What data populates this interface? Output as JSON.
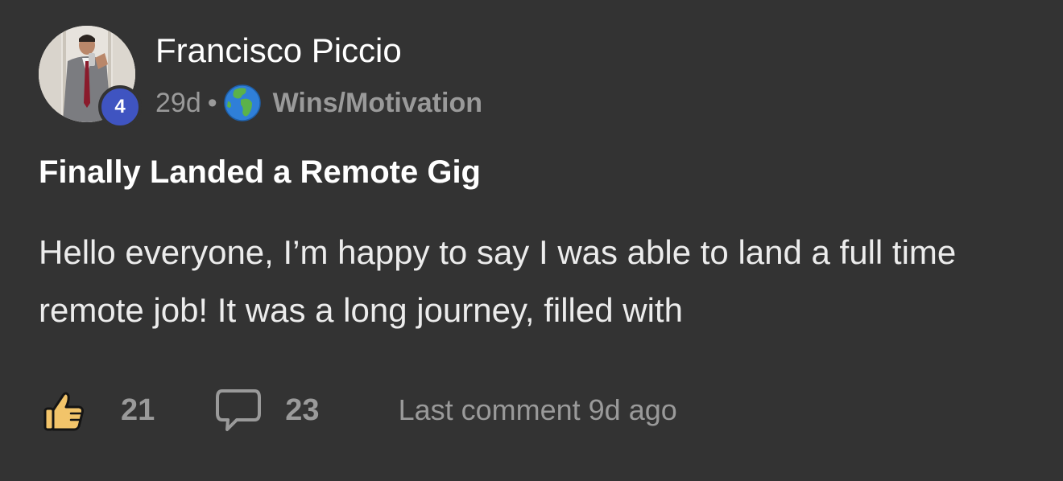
{
  "post": {
    "author": {
      "name": "Francisco Piccio",
      "level": "4"
    },
    "age": "29d",
    "separator": "•",
    "category": {
      "name": "Wins/Motivation",
      "icon": "globe-icon"
    },
    "title": "Finally Landed a Remote Gig",
    "body": "Hello everyone, I’m happy to say I was able to land a full time remote job! It was a long journey, filled with",
    "actions": {
      "likes": "21",
      "like_icon": "thumbs-up-icon",
      "comments": "23",
      "comment_icon": "comment-bubble-icon",
      "last_comment": "Last comment 9d ago"
    }
  },
  "colors": {
    "background": "#333333",
    "muted_text": "#9a9a9a",
    "badge": "#3f54c1",
    "like_icon": "#f2c46a"
  }
}
